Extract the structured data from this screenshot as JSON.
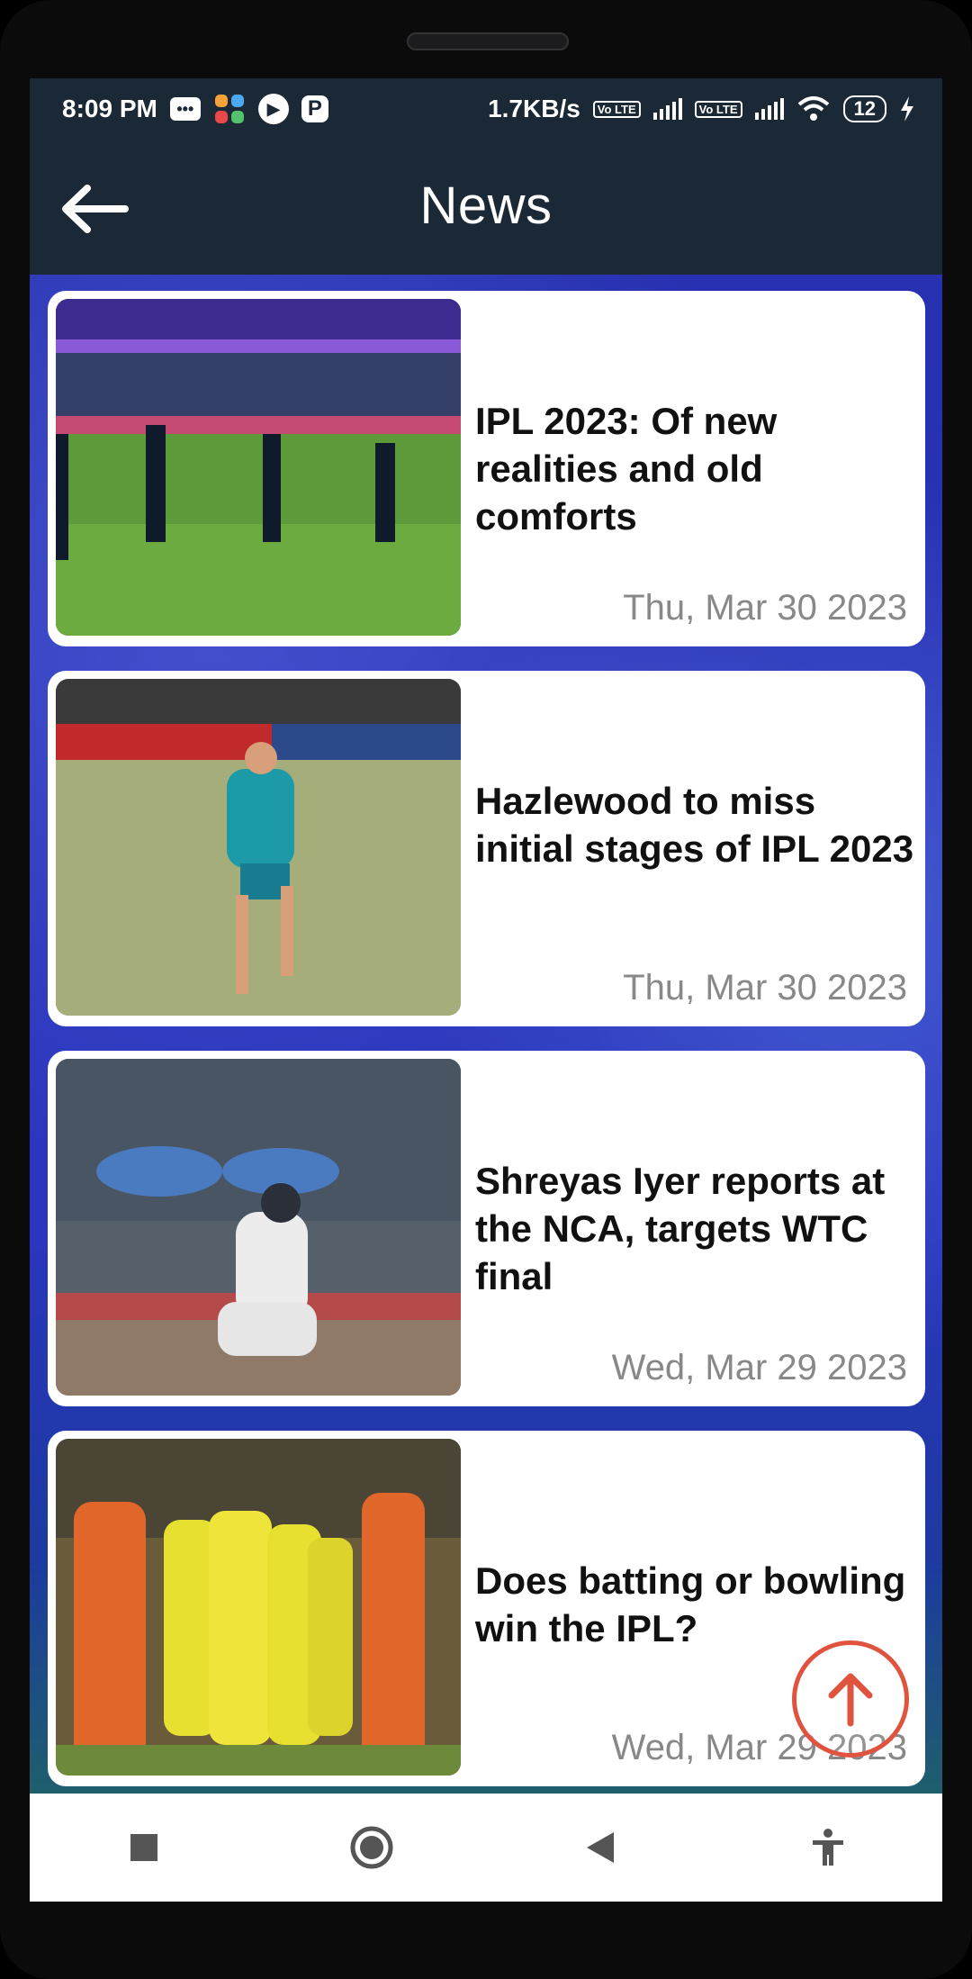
{
  "status_bar": {
    "time": "8:09 PM",
    "net_speed": "1.7KB/s",
    "volte1": "Vo LTE",
    "volte2": "Vo LTE",
    "battery": "12",
    "icons": [
      "message-icon",
      "pinwheel-icon",
      "video-call-icon",
      "p-app-icon",
      "signal-icon",
      "wifi-icon",
      "battery-icon",
      "charging-icon"
    ]
  },
  "appbar": {
    "title": "News",
    "back_icon": "arrow-left-icon"
  },
  "news": [
    {
      "title": "IPL 2023: Of new realities and old comforts",
      "date": "Thu, Mar 30 2023"
    },
    {
      "title": "Hazlewood to miss initial stages of IPL 2023",
      "date": "Thu, Mar 30 2023"
    },
    {
      "title": "Shreyas Iyer reports at the NCA, targets WTC final",
      "date": "Wed, Mar 29 2023"
    },
    {
      "title": "Does batting or bowling win the IPL?",
      "date": "Wed, Mar 29 2023"
    }
  ],
  "fab": {
    "icon": "arrow-up-icon",
    "color": "#e0533f"
  },
  "navbar": {
    "icons": [
      "square-icon",
      "home-circle-icon",
      "back-triangle-icon",
      "accessibility-icon"
    ]
  },
  "colors": {
    "appbar": "#1b2836",
    "background": "#2a35b8",
    "date_text": "#888888"
  }
}
